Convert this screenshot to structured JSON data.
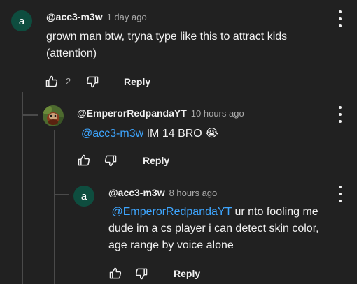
{
  "comments": [
    {
      "avatar_letter": "a",
      "handle": "@acc3-m3w",
      "time": "1 day ago",
      "text_line1": "grown man btw, tryna type like this to attract kids",
      "text_line2": "(attention)",
      "likes": "2",
      "reply_label": "Reply"
    },
    {
      "handle": "@EmperorRedpandaYT",
      "time": "10 hours ago",
      "mention": "@acc3-m3w",
      "text": " IM 14 BRO",
      "emoji": "😭",
      "reply_label": "Reply"
    },
    {
      "avatar_letter": "a",
      "handle": "@acc3-m3w",
      "time": "8 hours ago",
      "mention": "@EmperorRedpandaYT",
      "text_line1": " ur nto fooling me",
      "text_line2": "dude im a cs player i can detect skin color,",
      "text_line3": "age range by voice alone",
      "reply_label": "Reply"
    }
  ],
  "colors": {
    "background": "#212121",
    "avatar": "#0e4d3f",
    "mention": "#3ea6ff",
    "muted": "#aaaaaa"
  },
  "icons": [
    "thumbs-up-icon",
    "thumbs-down-icon",
    "more-vert-icon"
  ]
}
